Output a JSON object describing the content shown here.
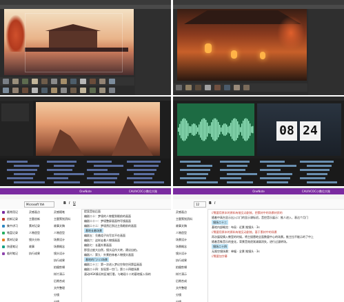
{
  "quad1": {
    "kind": "3d-render-app",
    "accent": "#e0622a",
    "material_colors": [
      "#7a7f86",
      "#9a8f7c",
      "#5d6b4f",
      "#c2b59a",
      "#6e5c4a",
      "#8a8a8a",
      "#a58e6a",
      "#4d5d6a",
      "#b7b7b7",
      "#6a4c3a",
      "#938373",
      "#7c8c9c"
    ]
  },
  "quad2": {
    "kind": "3d-render-app",
    "material_colors": [
      "#6a6a6a",
      "#8e7e62",
      "#5a4a3a",
      "#a0a0a0",
      "#705040",
      "#4a5a6a",
      "#9a8a7a",
      "#7a6a5a"
    ]
  },
  "quad3": {
    "kind": "video-editor",
    "track_color": "#5b6ea0"
  },
  "quad4": {
    "kind": "video-editor",
    "clock": {
      "hours": "08",
      "minutes": "24"
    },
    "waveform_color": "#2fa86a"
  },
  "onenote_left": {
    "app_title": "OneNote",
    "user": "CAUIVCOC小数位大账",
    "tabs": [
      "文件",
      "开始",
      "插入",
      "绘图",
      "历史记录",
      "审阅",
      "视图",
      "帮助"
    ],
    "font_name": "Microsoft Yah",
    "notebooks": [
      {
        "label": "最常用记",
        "color": "#7a2aa0"
      },
      {
        "label": "创新记录",
        "color": "#c0392b"
      },
      {
        "label": "集中讲习",
        "color": "#2e86c1"
      },
      {
        "label": "笔盘记录",
        "color": "#27ae60"
      },
      {
        "label": "素材记录",
        "color": "#e67e22"
      },
      {
        "label": "快速笔记",
        "color": "#16a085"
      },
      {
        "label": "临时笔记",
        "color": "#8e44ad"
      }
    ],
    "sections": [
      "灵感画点",
      "主题创新",
      "素材记录",
      "人物造型",
      "镜头分析",
      "故事",
      "执行成果"
    ],
    "pages": [
      "灵感随笔",
      "主题策划资料",
      "故事文稿",
      "人物造型",
      "场景设计",
      "场景概念",
      "镜头设计",
      "执行成果",
      "拍摄剪辑",
      "样片演示",
      "后期合成",
      "文件整理",
      "分镜",
      "分镜",
      "分镜"
    ],
    "content_lines": [
      {
        "text": "提案音轨后面",
        "style": "normal"
      },
      {
        "text": "编剧二十：梦境的人物看到眼前的画面",
        "style": "normal"
      },
      {
        "text": "编剧二十一：梦境整屏画面特写镜画面",
        "style": "normal"
      },
      {
        "text": "编剧二十二：梦境然后到达主角眼前的画面",
        "style": "normal"
      },
      {
        "text": "基地长着场景",
        "style": "heading"
      },
      {
        "text": "编剧五：兑着组子向写实不在画面",
        "style": "normal"
      },
      {
        "text": "编剧六：这样走着人物镜画面",
        "style": "normal"
      },
      {
        "text": "编剧七：长嘉外景画面",
        "style": "normal"
      },
      {
        "text": "那里过度大自然，镜头运作大转，建议自拍。",
        "style": "normal"
      },
      {
        "text": "编剧八：第九：外景拍林者人物镜头画面",
        "style": "normal"
      },
      {
        "text": "基地的门人口场景",
        "style": "heading"
      },
      {
        "text": "编剧二十三：第一次进入梦幻空和空间第层画面",
        "style": "normal"
      },
      {
        "text": "编剧二十四：发现第一空门，第二十四楼场景",
        "style": "normal"
      },
      {
        "text": "滚动HGK情况的区域打看，与略现十二的基地接入场的",
        "style": "normal"
      }
    ]
  },
  "onenote_right": {
    "app_title": "OneNote",
    "user": "CAUIVCOC小数位大账",
    "tabs": [
      "文件",
      "开始",
      "插入",
      "绘图",
      "历史记录",
      "审阅",
      "视图",
      "帮助"
    ],
    "font_size": "12",
    "sections": [
      "灵感画点",
      "主题策划资料",
      "故事文稿",
      "人物造型",
      "场景设计",
      "场景概念",
      "镜头设计",
      "执行成果",
      "拍摄剪辑",
      "样片演示",
      "后期合成",
      "文件整理",
      "分镜",
      "分镜",
      "分镜"
    ],
    "content_lines": [
      {
        "text": "//需要用原本的原料有能见动剧效，把素材中的场景材质的",
        "style": "red"
      },
      {
        "text": "随着中高台显示出入口门的显示课标初，音控音乐展示：推人进入、表达个月门",
        "style": "normal"
      },
      {
        "text": "镜场二十三",
        "style": "heading"
      },
      {
        "text": "基地内部概览：布局 · 近景 推镜头 · 3s",
        "style": "normal"
      },
      {
        "text": "//需要用原本的原料有能见动剧效，基于素材中的场景",
        "style": "red"
      },
      {
        "text": "再次展现情入教室的时候，将主接替地全面数量中心的场景。推主拉不能示的了中上",
        "style": "normal"
      },
      {
        "text": "随着音象音乐的变化，背景音效逐渐减弱消失，进行过渡转场。",
        "style": "normal"
      },
      {
        "text": "镜场二十四",
        "style": "heading"
      },
      {
        "text": "无限空镜场景：单幅 · 全景 推镜头 · 3s",
        "style": "normal"
      },
      {
        "text": "//需要加字幕",
        "style": "red"
      }
    ]
  }
}
